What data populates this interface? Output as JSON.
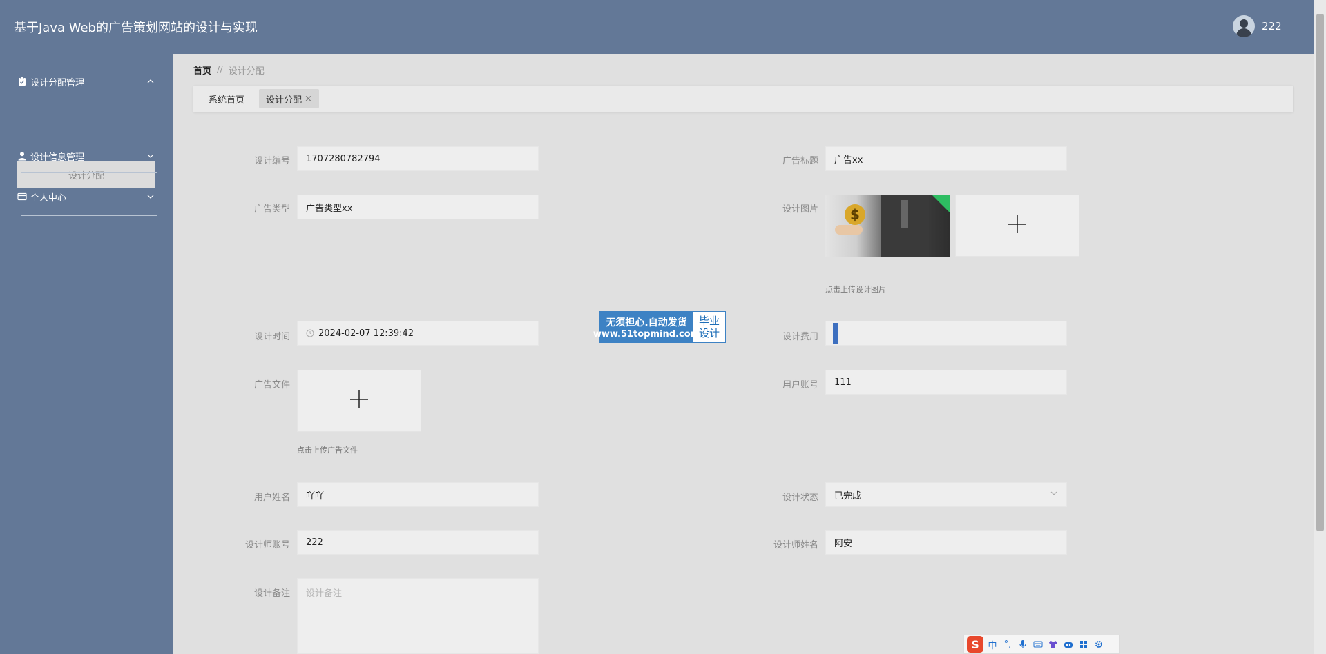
{
  "app": {
    "title": "基于Java Web的广告策划网站的设计与实现"
  },
  "user": {
    "name": "222"
  },
  "sidebar": {
    "groups": [
      {
        "label": "设计分配管理",
        "icon": "clipboard-icon",
        "expanded": true,
        "items": [
          {
            "label": "设计分配",
            "active": true
          }
        ]
      },
      {
        "label": "设计信息管理",
        "icon": "user-icon",
        "expanded": false
      },
      {
        "label": "个人中心",
        "icon": "card-icon",
        "expanded": false
      }
    ]
  },
  "breadcrumb": {
    "home": "首页",
    "separator": "//",
    "current": "设计分配"
  },
  "tabs": [
    {
      "label": "系统首页",
      "active": false
    },
    {
      "label": "设计分配",
      "active": true,
      "closable": true,
      "close_glyph": "×"
    }
  ],
  "form": {
    "design_no": {
      "label": "设计编号",
      "value": "1707280782794"
    },
    "ad_title": {
      "label": "广告标题",
      "value": "广告xx"
    },
    "ad_type": {
      "label": "广告类型",
      "value": "广告类型xx"
    },
    "design_image": {
      "label": "设计图片",
      "hint": "点击上传设计图片"
    },
    "design_time": {
      "label": "设计时间",
      "value": "2024-02-07 12:39:42"
    },
    "design_fee": {
      "label": "设计费用",
      "value": ""
    },
    "ad_file": {
      "label": "广告文件",
      "hint": "点击上传广告文件"
    },
    "user_account": {
      "label": "用户账号",
      "value": "111"
    },
    "user_name": {
      "label": "用户姓名",
      "value": "吖吖"
    },
    "design_status": {
      "label": "设计状态",
      "value": "已完成"
    },
    "designer_account": {
      "label": "设计师账号",
      "value": "222"
    },
    "designer_name": {
      "label": "设计师姓名",
      "value": "阿安"
    },
    "design_note": {
      "label": "设计备注",
      "placeholder": "设计备注"
    }
  },
  "watermark": {
    "line1": "无须担心.自动发货",
    "line2": "www.51topmind.com",
    "right_top": "毕业",
    "right_bottom": "设计"
  },
  "ime": {
    "logo": "S",
    "buttons": [
      "中",
      "°,",
      "mic-icon",
      "keyboard-icon",
      "shirt-icon",
      "bot-icon",
      "grid-icon",
      "settings-icon"
    ],
    "mode_label": "中",
    "punct_label": "°,"
  },
  "colors": {
    "header": "#637897",
    "sidebar": "#637897",
    "content_bg": "#e0e0e0",
    "field_bg": "#eeeeee",
    "watermark_blue": "#3d82c4"
  }
}
